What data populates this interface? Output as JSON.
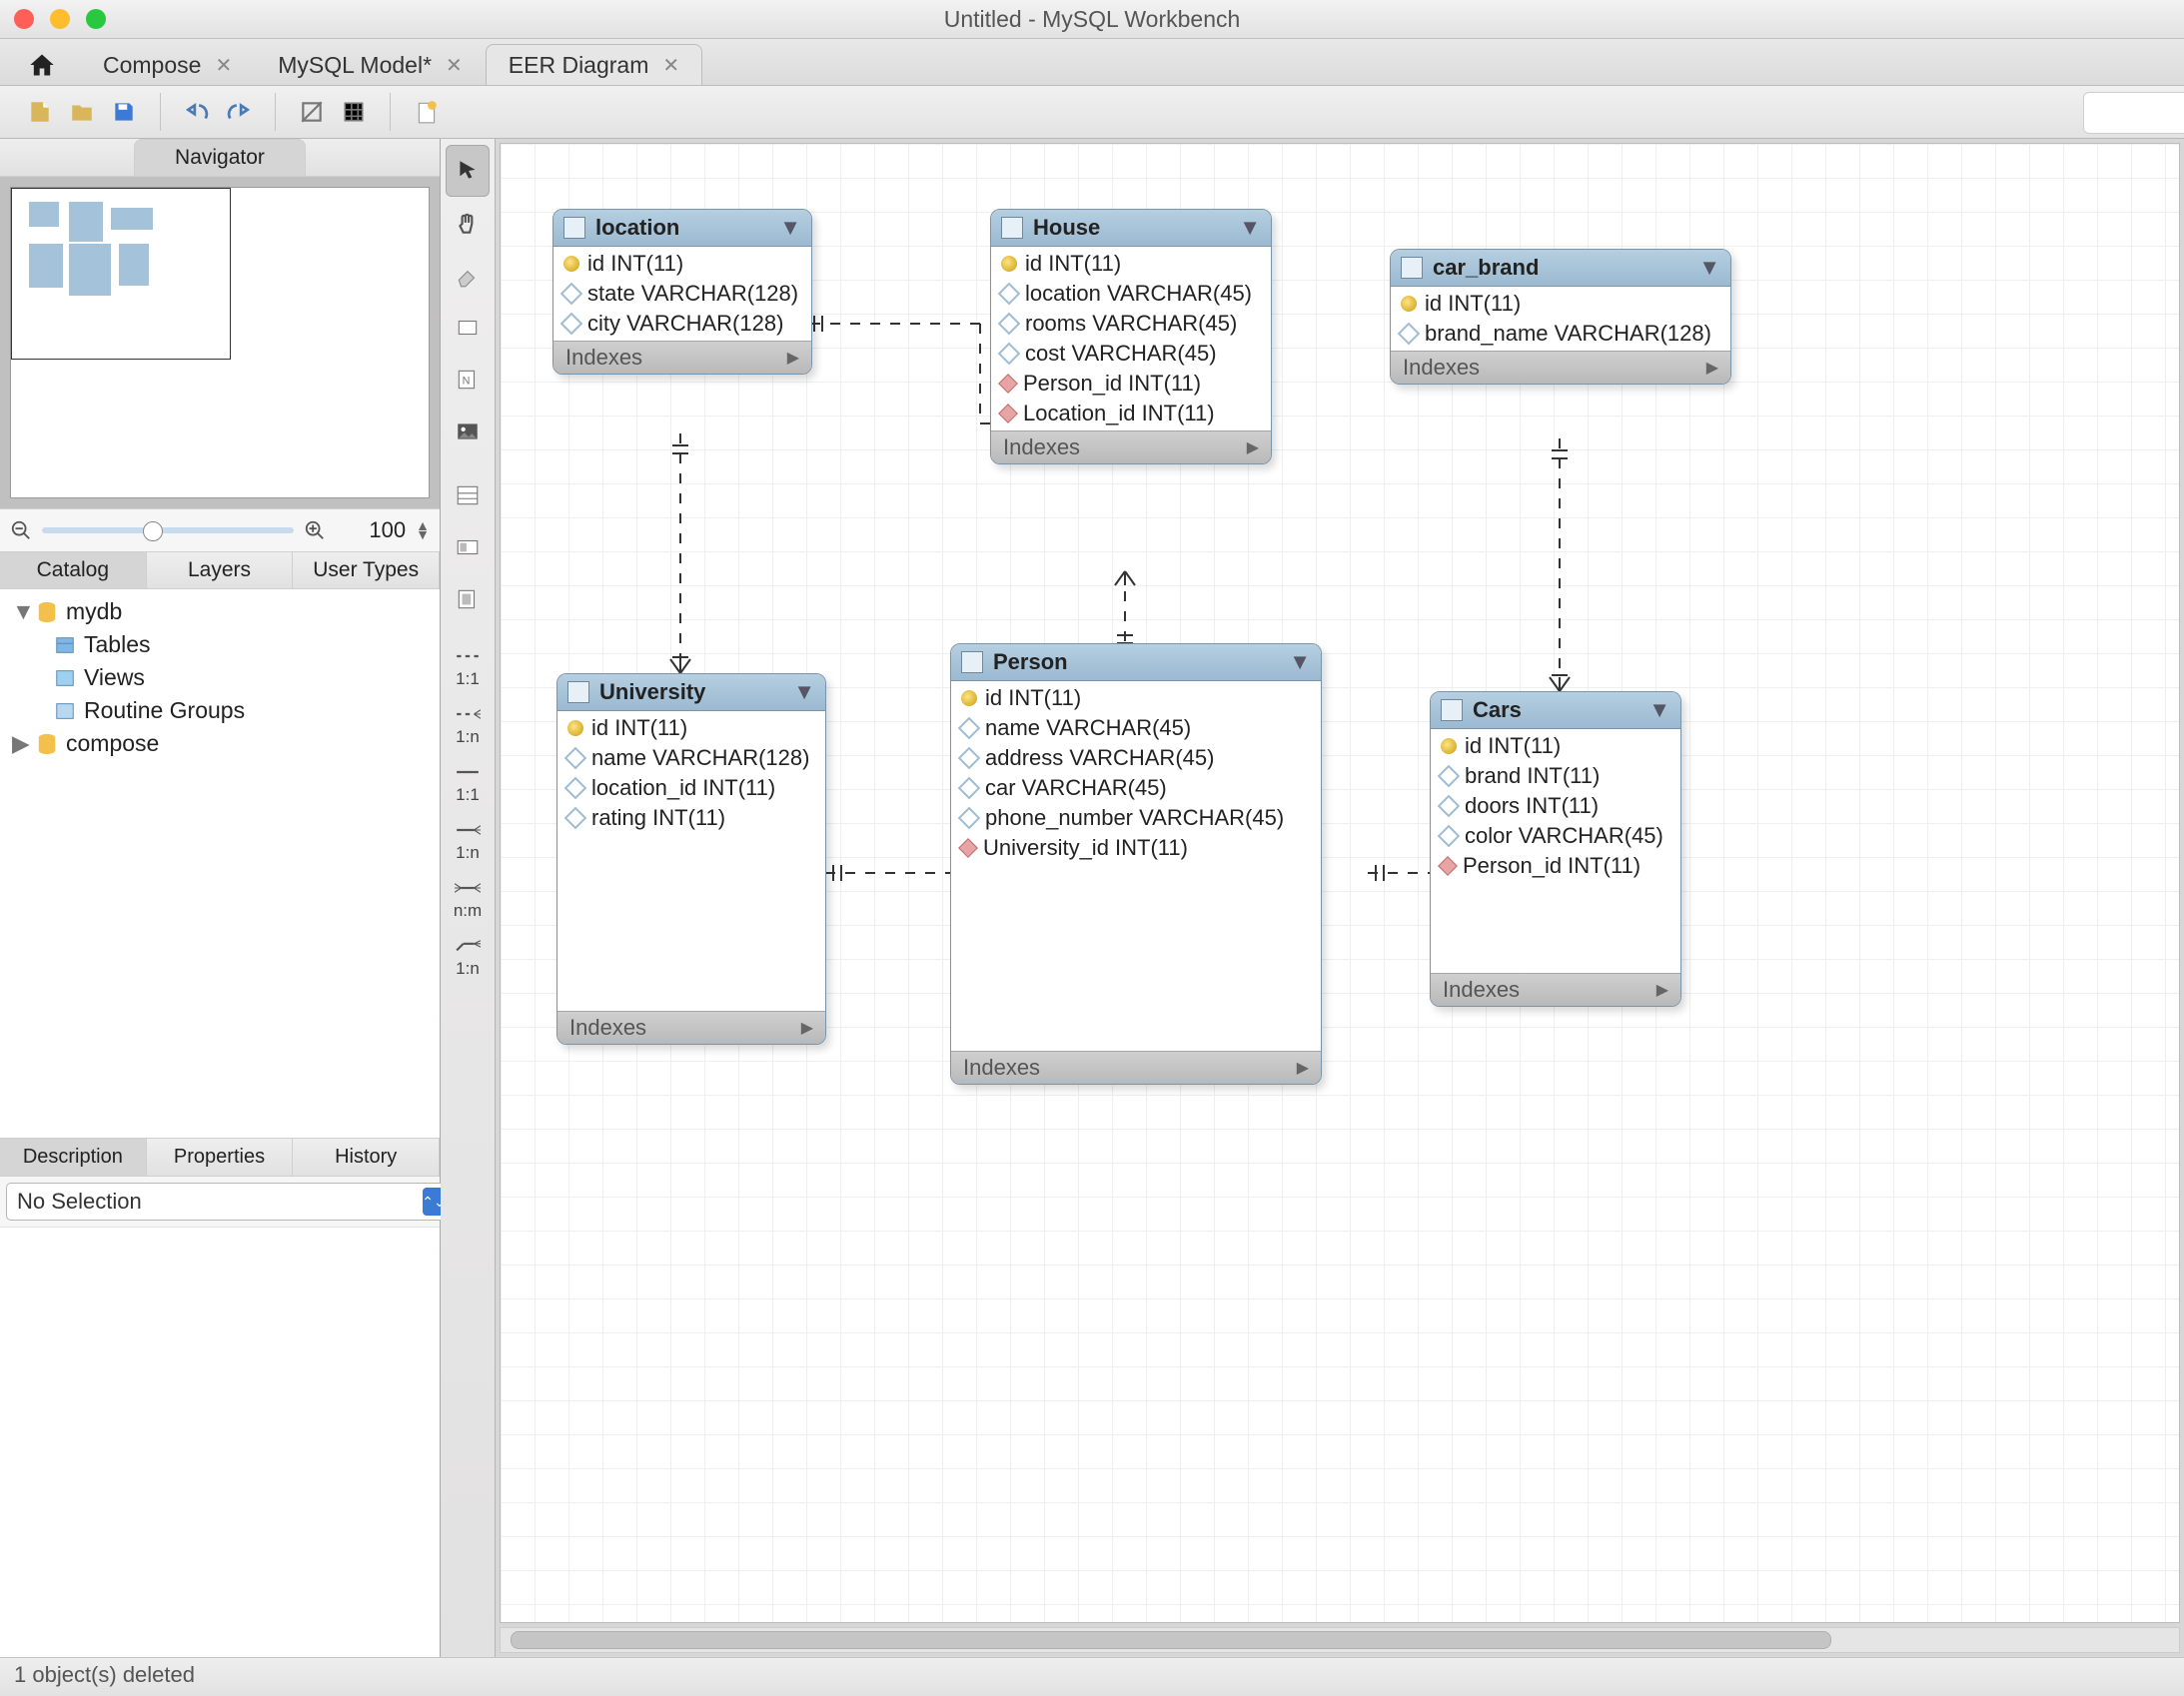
{
  "window": {
    "title": "Untitled - MySQL Workbench"
  },
  "tabs": [
    {
      "label": "Compose",
      "active": false
    },
    {
      "label": "MySQL Model*",
      "active": false
    },
    {
      "label": "EER Diagram",
      "active": true
    }
  ],
  "sidebar": {
    "navigator_label": "Navigator",
    "zoom_value": "100",
    "catalog_tabs": {
      "catalog": "Catalog",
      "layers": "Layers",
      "usertypes": "User Types"
    },
    "tree": {
      "db1": "mydb",
      "tables": "Tables",
      "views": "Views",
      "routines": "Routine Groups",
      "db2": "compose"
    },
    "bottom_tabs": {
      "description": "Description",
      "properties": "Properties",
      "history": "History"
    },
    "selection": "No Selection"
  },
  "vtoolbar": {
    "rel_11": "1:1",
    "rel_1n": "1:n",
    "rel_11b": "1:1",
    "rel_1nb": "1:n",
    "rel_nm": "n:m",
    "rel_1nc": "1:n"
  },
  "entities": {
    "location": {
      "title": "location",
      "cols": [
        {
          "k": "pk",
          "t": "id INT(11)"
        },
        {
          "k": "col",
          "t": "state VARCHAR(128)"
        },
        {
          "k": "col",
          "t": "city VARCHAR(128)"
        }
      ]
    },
    "house": {
      "title": "House",
      "cols": [
        {
          "k": "pk",
          "t": "id INT(11)"
        },
        {
          "k": "col",
          "t": "location VARCHAR(45)"
        },
        {
          "k": "col",
          "t": "rooms VARCHAR(45)"
        },
        {
          "k": "col",
          "t": "cost VARCHAR(45)"
        },
        {
          "k": "fk",
          "t": "Person_id INT(11)"
        },
        {
          "k": "fk",
          "t": "Location_id INT(11)"
        }
      ]
    },
    "car_brand": {
      "title": "car_brand",
      "cols": [
        {
          "k": "pk",
          "t": "id INT(11)"
        },
        {
          "k": "col",
          "t": "brand_name VARCHAR(128)"
        }
      ]
    },
    "university": {
      "title": "University",
      "cols": [
        {
          "k": "pk",
          "t": "id INT(11)"
        },
        {
          "k": "col",
          "t": "name VARCHAR(128)"
        },
        {
          "k": "col",
          "t": "location_id INT(11)"
        },
        {
          "k": "col",
          "t": "rating INT(11)"
        }
      ]
    },
    "person": {
      "title": "Person",
      "cols": [
        {
          "k": "pk",
          "t": "id INT(11)"
        },
        {
          "k": "col",
          "t": "name VARCHAR(45)"
        },
        {
          "k": "col",
          "t": "address VARCHAR(45)"
        },
        {
          "k": "col",
          "t": "car VARCHAR(45)"
        },
        {
          "k": "col",
          "t": "phone_number VARCHAR(45)"
        },
        {
          "k": "fk",
          "t": "University_id INT(11)"
        }
      ]
    },
    "cars": {
      "title": "Cars",
      "cols": [
        {
          "k": "pk",
          "t": "id INT(11)"
        },
        {
          "k": "col",
          "t": "brand INT(11)"
        },
        {
          "k": "col",
          "t": "doors INT(11)"
        },
        {
          "k": "col",
          "t": "color VARCHAR(45)"
        },
        {
          "k": "fk",
          "t": "Person_id INT(11)"
        }
      ]
    }
  },
  "indexes_label": "Indexes",
  "status": "1 object(s) deleted"
}
